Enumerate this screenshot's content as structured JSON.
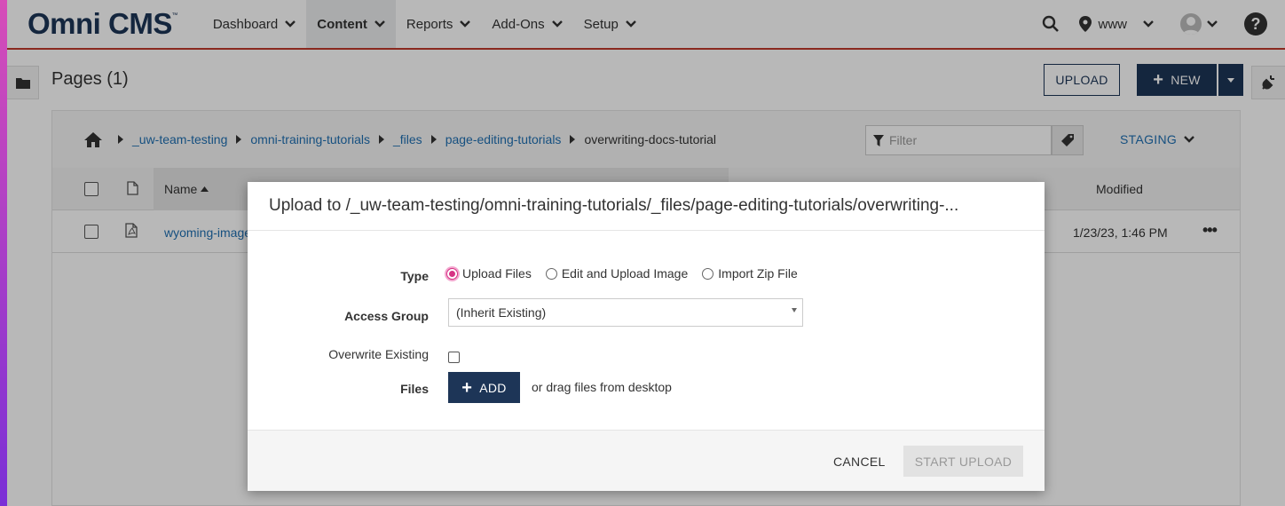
{
  "app": {
    "logo": "Omni CMS",
    "logo_mark": "™"
  },
  "nav": {
    "items": [
      {
        "label": "Dashboard",
        "active": false
      },
      {
        "label": "Content",
        "active": true
      },
      {
        "label": "Reports",
        "active": false
      },
      {
        "label": "Add-Ons",
        "active": false
      },
      {
        "label": "Setup",
        "active": false
      }
    ],
    "site": "www",
    "help": "?"
  },
  "page": {
    "title": "Pages (1)",
    "upload_label": "UPLOAD",
    "new_label": "NEW"
  },
  "breadcrumb": {
    "items": [
      "_uw-team-testing",
      "omni-training-tutorials",
      "_files",
      "page-editing-tutorials"
    ],
    "current": "overwriting-docs-tutorial"
  },
  "filter": {
    "placeholder": "Filter"
  },
  "environment": "STAGING",
  "table": {
    "headers": {
      "name": "Name",
      "modified": "Modified"
    },
    "rows": [
      {
        "name": "wyoming-image",
        "modified": "1/23/23, 1:46 PM",
        "actions": "•••"
      }
    ]
  },
  "modal": {
    "title": "Upload to /_uw-team-testing/omni-training-tutorials/_files/page-editing-tutorials/overwriting-...",
    "type_label": "Type",
    "type_options": [
      "Upload Files",
      "Edit and Upload Image",
      "Import Zip File"
    ],
    "type_selected": "Upload Files",
    "access_group_label": "Access Group",
    "access_group_value": "(Inherit Existing)",
    "overwrite_label": "Overwrite Existing",
    "overwrite_checked": false,
    "files_label": "Files",
    "add_label": "ADD",
    "drag_text": "or drag files from desktop",
    "cancel_label": "CANCEL",
    "start_label": "START UPLOAD"
  },
  "colors": {
    "brand": "#1d3557",
    "link": "#1f6fb2",
    "nav_accent": "#c0392b",
    "radio_selected": "#d63384"
  }
}
